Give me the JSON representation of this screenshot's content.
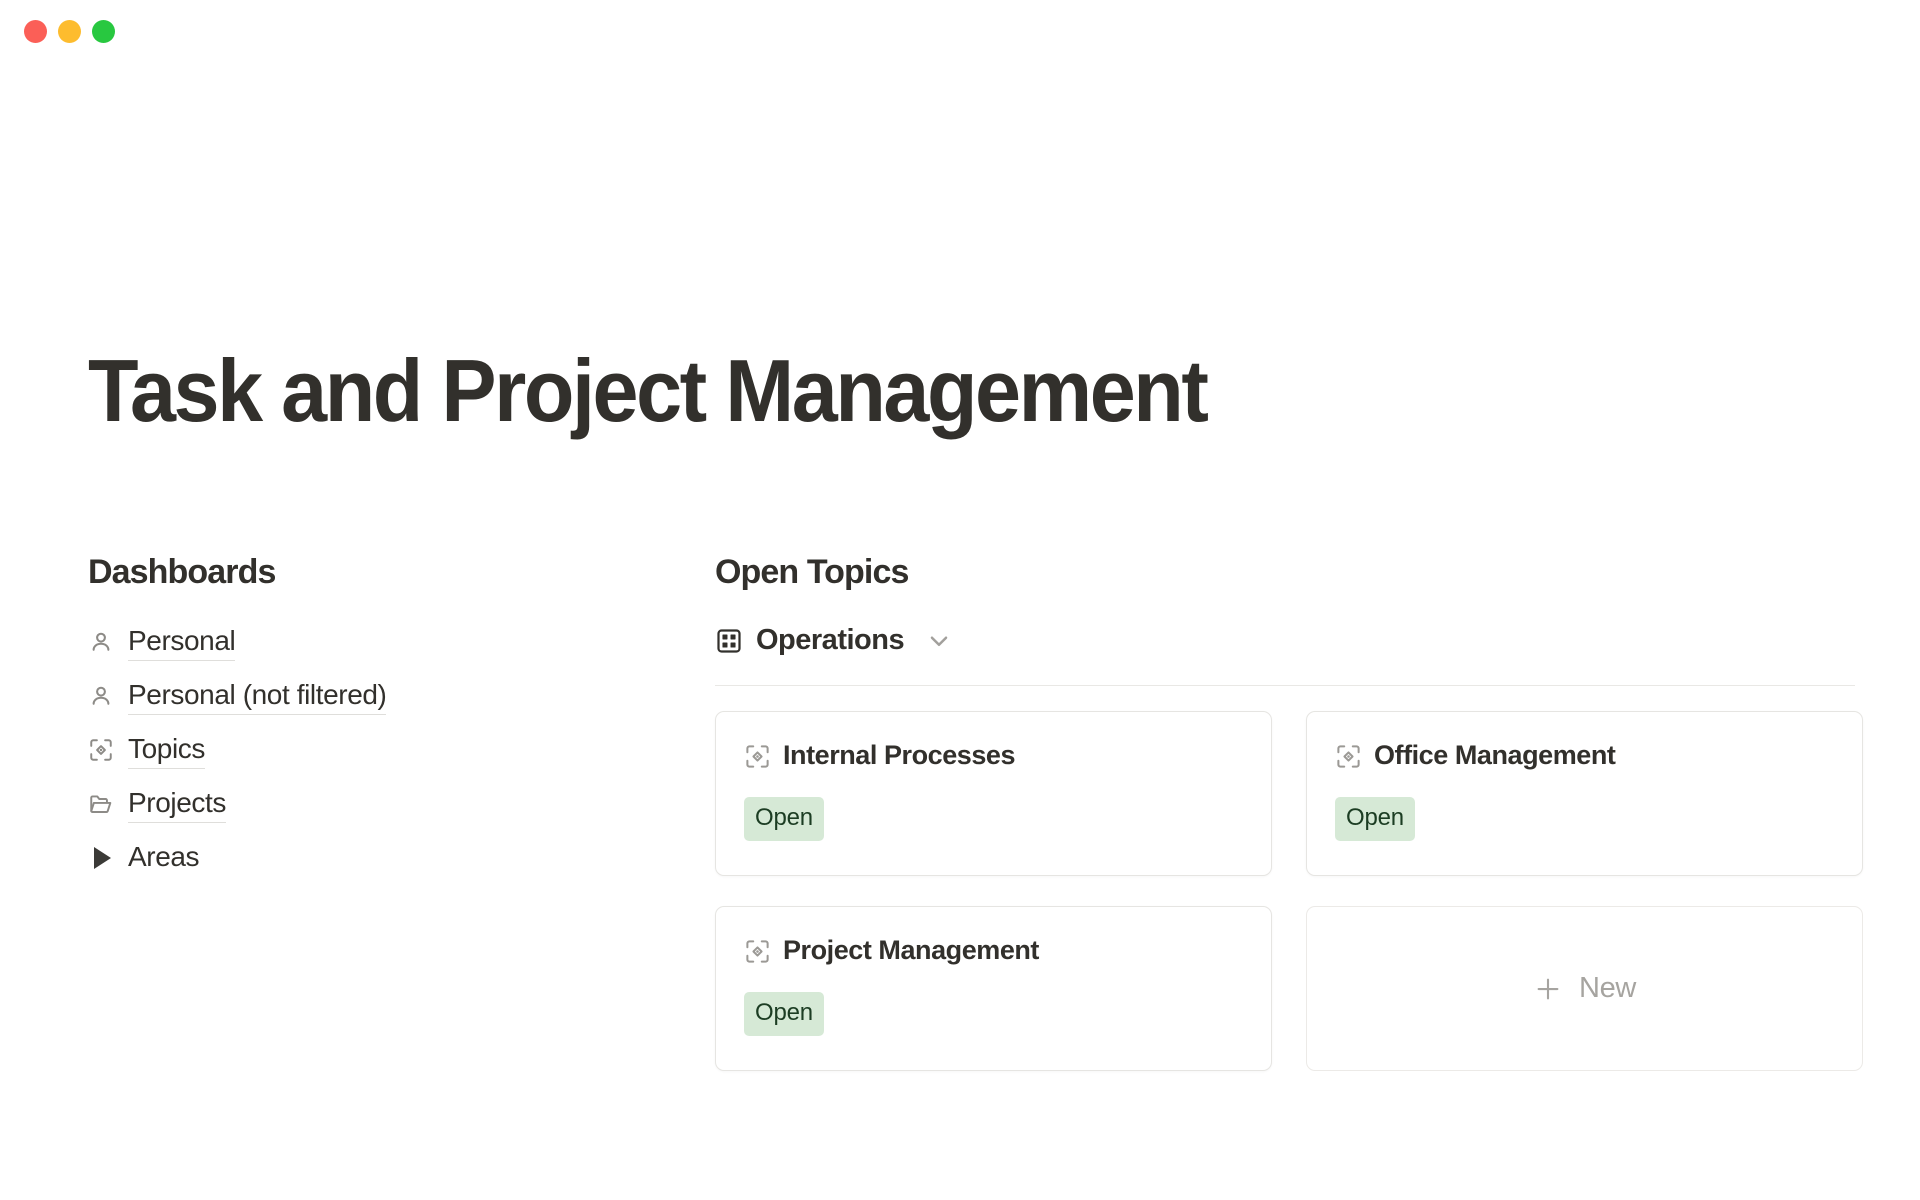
{
  "window": {
    "controls": [
      {
        "name": "close",
        "color": "#fb5f57"
      },
      {
        "name": "minimize",
        "color": "#fdbc2e"
      },
      {
        "name": "maximize",
        "color": "#28c840"
      }
    ]
  },
  "page": {
    "title": "Task and Project Management"
  },
  "dashboards": {
    "heading": "Dashboards",
    "items": [
      {
        "label": "Personal",
        "icon": "person-icon",
        "underline": true
      },
      {
        "label": "Personal (not filtered)",
        "icon": "person-icon",
        "underline": true
      },
      {
        "label": "Topics",
        "icon": "topic-scan-icon",
        "underline": true
      },
      {
        "label": "Projects",
        "icon": "folder-open-icon",
        "underline": true
      },
      {
        "label": "Areas",
        "icon": "triangle-collapsed-icon",
        "underline": false
      }
    ]
  },
  "open_topics": {
    "heading": "Open Topics",
    "database": {
      "name": "Operations",
      "icon": "database-grid-icon",
      "chevron": "chevron-down-icon"
    },
    "cards": [
      {
        "title": "Internal Processes",
        "icon": "topic-scan-icon",
        "status": "Open",
        "type": "topic"
      },
      {
        "title": "Office Management",
        "icon": "topic-scan-icon",
        "status": "Open",
        "type": "topic"
      },
      {
        "title": "Project Management",
        "icon": "topic-scan-icon",
        "status": "Open",
        "type": "topic"
      },
      {
        "title": "New",
        "icon": "plus-icon",
        "type": "new"
      }
    ]
  },
  "colors": {
    "text": "#32302c",
    "muted": "#a6a4a0",
    "icon": "#8d8b87",
    "border": "#e6e5e2",
    "status_open_bg": "#d6e9d6",
    "status_open_text": "#1c3d23"
  }
}
